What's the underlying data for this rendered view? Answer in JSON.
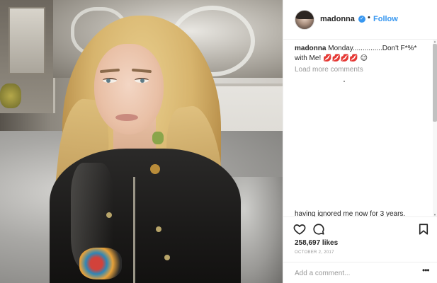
{
  "post": {
    "username": "madonna",
    "verified_badge": "✓",
    "separator": "•",
    "follow_label": "Follow",
    "caption_user": "madonna",
    "caption_text": "Monday...............Don't F*%* with Me! 💋💋💋💋 😉",
    "load_more_label": "Load more comments",
    "partial_comment": "having ignored me now for 3 years.",
    "likes": "258,697 likes",
    "date": "OCTOBER 2, 2017",
    "comment_placeholder": "Add a comment...",
    "more_options": "•••"
  },
  "icons": {
    "like": "heart-icon",
    "comment": "comment-icon",
    "save": "bookmark-icon",
    "verified": "verified-badge-icon",
    "more": "more-options-icon"
  },
  "colors": {
    "link_blue": "#3897f0",
    "muted_text": "#999999",
    "text": "#262626",
    "border": "#efefef"
  }
}
